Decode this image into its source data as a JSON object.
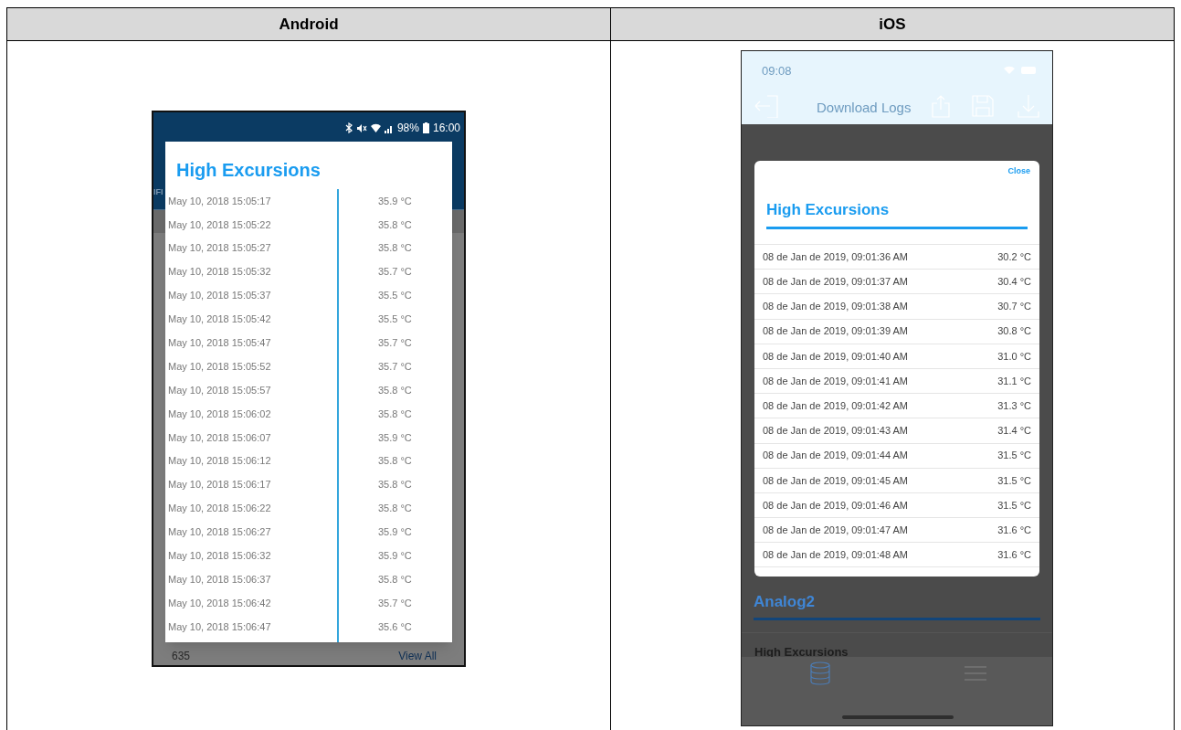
{
  "table": {
    "columns": [
      {
        "heading": "Android"
      },
      {
        "heading": "iOS"
      }
    ]
  },
  "android": {
    "status_bar": {
      "battery": "98%",
      "time": "16:00"
    },
    "background": {
      "tab_fragment": "IFI",
      "count": "635",
      "link": "View All"
    },
    "dialog": {
      "title": "High Excursions",
      "rows": [
        {
          "time": "May 10, 2018 15:05:17",
          "value": "35.9 °C"
        },
        {
          "time": "May 10, 2018 15:05:22",
          "value": "35.8 °C"
        },
        {
          "time": "May 10, 2018 15:05:27",
          "value": "35.8 °C"
        },
        {
          "time": "May 10, 2018 15:05:32",
          "value": "35.7 °C"
        },
        {
          "time": "May 10, 2018 15:05:37",
          "value": "35.5 °C"
        },
        {
          "time": "May 10, 2018 15:05:42",
          "value": "35.5 °C"
        },
        {
          "time": "May 10, 2018 15:05:47",
          "value": "35.7 °C"
        },
        {
          "time": "May 10, 2018 15:05:52",
          "value": "35.7 °C"
        },
        {
          "time": "May 10, 2018 15:05:57",
          "value": "35.8 °C"
        },
        {
          "time": "May 10, 2018 15:06:02",
          "value": "35.8 °C"
        },
        {
          "time": "May 10, 2018 15:06:07",
          "value": "35.9 °C"
        },
        {
          "time": "May 10, 2018 15:06:12",
          "value": "35.8 °C"
        },
        {
          "time": "May 10, 2018 15:06:17",
          "value": "35.8 °C"
        },
        {
          "time": "May 10, 2018 15:06:22",
          "value": "35.8 °C"
        },
        {
          "time": "May 10, 2018 15:06:27",
          "value": "35.9 °C"
        },
        {
          "time": "May 10, 2018 15:06:32",
          "value": "35.9 °C"
        },
        {
          "time": "May 10, 2018 15:06:37",
          "value": "35.8 °C"
        },
        {
          "time": "May 10, 2018 15:06:42",
          "value": "35.7 °C"
        },
        {
          "time": "May 10, 2018 15:06:47",
          "value": "35.6 °C"
        }
      ]
    }
  },
  "ios": {
    "status_bar": {
      "time": "09:08"
    },
    "nav": {
      "title": "Download Logs"
    },
    "dialog": {
      "close": "Close",
      "title": "High Excursions",
      "rows": [
        {
          "time": "08 de Jan de 2019, 09:01:36 AM",
          "value": "30.2 °C"
        },
        {
          "time": "08 de Jan de 2019, 09:01:37 AM",
          "value": "30.4 °C"
        },
        {
          "time": "08 de Jan de 2019, 09:01:38 AM",
          "value": "30.7 °C"
        },
        {
          "time": "08 de Jan de 2019, 09:01:39 AM",
          "value": "30.8 °C"
        },
        {
          "time": "08 de Jan de 2019, 09:01:40 AM",
          "value": "31.0 °C"
        },
        {
          "time": "08 de Jan de 2019, 09:01:41 AM",
          "value": "31.1 °C"
        },
        {
          "time": "08 de Jan de 2019, 09:01:42 AM",
          "value": "31.3 °C"
        },
        {
          "time": "08 de Jan de 2019, 09:01:43 AM",
          "value": "31.4 °C"
        },
        {
          "time": "08 de Jan de 2019, 09:01:44 AM",
          "value": "31.5 °C"
        },
        {
          "time": "08 de Jan de 2019, 09:01:45 AM",
          "value": "31.5 °C"
        },
        {
          "time": "08 de Jan de 2019, 09:01:46 AM",
          "value": "31.5 °C"
        },
        {
          "time": "08 de Jan de 2019, 09:01:47 AM",
          "value": "31.6 °C"
        },
        {
          "time": "08 de Jan de 2019, 09:01:48 AM",
          "value": "31.6 °C"
        }
      ]
    },
    "section": {
      "title": "Analog2",
      "item": "High Excursions"
    }
  }
}
